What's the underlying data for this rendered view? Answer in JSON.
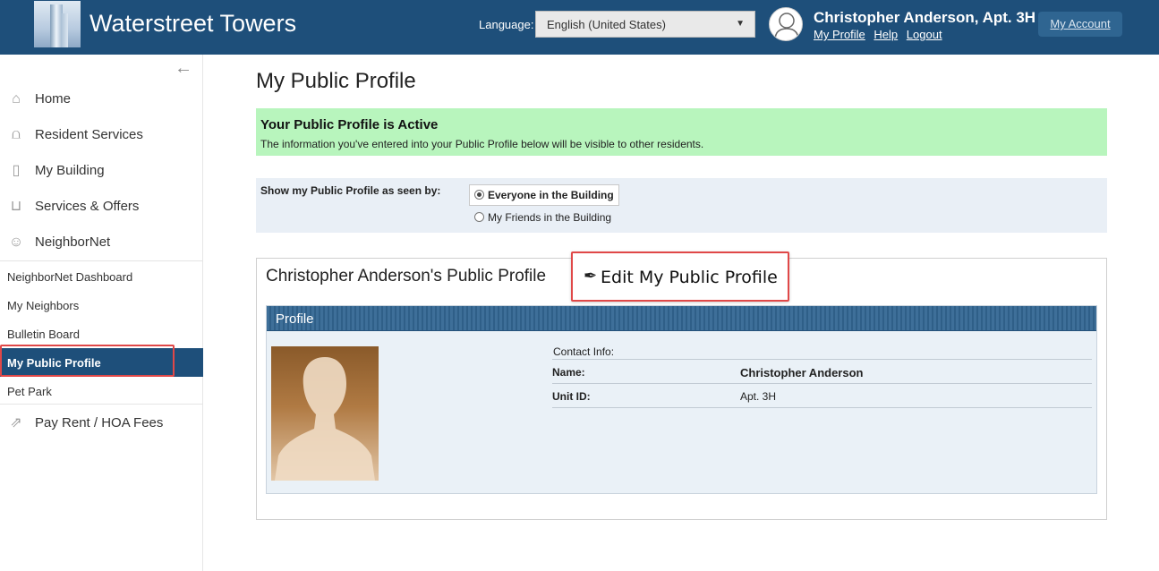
{
  "header": {
    "brand": "Waterstreet Towers",
    "language_label": "Language:",
    "language_value": "English (United States)",
    "user_name": "Christopher Anderson, Apt. 3H",
    "links": [
      "My Profile",
      "Help",
      "Logout"
    ],
    "my_account": "My Account"
  },
  "sidebar": {
    "items": [
      {
        "label": "Home",
        "icon": "home-icon"
      },
      {
        "label": "Resident Services",
        "icon": "bell-icon"
      },
      {
        "label": "My Building",
        "icon": "building-icon"
      },
      {
        "label": "Services & Offers",
        "icon": "basket-icon"
      },
      {
        "label": "NeighborNet",
        "icon": "people-icon"
      }
    ],
    "subitems": [
      "NeighborNet Dashboard",
      "My Neighbors",
      "Bulletin Board",
      "My Public Profile",
      "Pet Park"
    ],
    "active_subitem": "My Public Profile",
    "pay": {
      "label": "Pay Rent / HOA Fees",
      "icon": "pay-icon"
    }
  },
  "main": {
    "title": "My Public Profile",
    "banner_title": "Your Public Profile is Active",
    "banner_text": "The information you've entered into your Public Profile below will be visible to other residents.",
    "seen_by_label": "Show my Public Profile as seen by:",
    "options": [
      "Everyone in the Building",
      "My Friends in the Building"
    ],
    "selected_option": "Everyone in the Building",
    "panel_title": "Christopher Anderson's Public Profile",
    "edit_button": "Edit My Public Profile",
    "section_title": "Profile",
    "contact_label": "Contact Info:",
    "fields": [
      {
        "key": "Name:",
        "value": "Christopher Anderson"
      },
      {
        "key": "Unit ID:",
        "value": "Apt. 3H"
      }
    ]
  },
  "colors": {
    "header": "#1e4f7a",
    "banner": "#b8f5bd",
    "highlight": "#e04848"
  }
}
